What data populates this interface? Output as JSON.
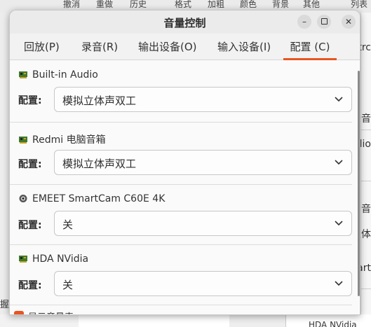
{
  "background": {
    "top_menu": [
      "撤消",
      "重做",
      "历史",
      "格式",
      "加粗",
      "颜色",
      "背景",
      "其他",
      "列表"
    ],
    "right_edge": [
      "trc",
      "录音",
      "dio",
      "音",
      "立体",
      "art"
    ],
    "left_edge": "握",
    "bottom_right": "HDA NVidia"
  },
  "window": {
    "title": "音量控制",
    "controls": {
      "minimize": "–",
      "maximize": "□",
      "close": "✕"
    }
  },
  "tabs": [
    {
      "label": "回放(P)",
      "active": false
    },
    {
      "label": "录音(R)",
      "active": false
    },
    {
      "label": "输出设备(O)",
      "active": false
    },
    {
      "label": "输入设备(I)",
      "active": false
    },
    {
      "label": "配置 (C)",
      "active": true
    }
  ],
  "devices": [
    {
      "name": "Built-in Audio",
      "icon": "sound-card-icon",
      "profile_label": "配置:",
      "profile_value": "模拟立体声双工"
    },
    {
      "name": "Redmi 电脑音箱",
      "icon": "sound-card-icon",
      "profile_label": "配置:",
      "profile_value": "模拟立体声双工"
    },
    {
      "name": "EMEET SmartCam C60E 4K",
      "icon": "webcam-icon",
      "profile_label": "配置:",
      "profile_value": "关"
    },
    {
      "name": "HDA NVidia",
      "icon": "sound-card-icon",
      "profile_label": "配置:",
      "profile_value": "关"
    }
  ],
  "footer": {
    "show_volume_meters_label": "显示音量表"
  },
  "colors": {
    "accent": "#e95420"
  }
}
